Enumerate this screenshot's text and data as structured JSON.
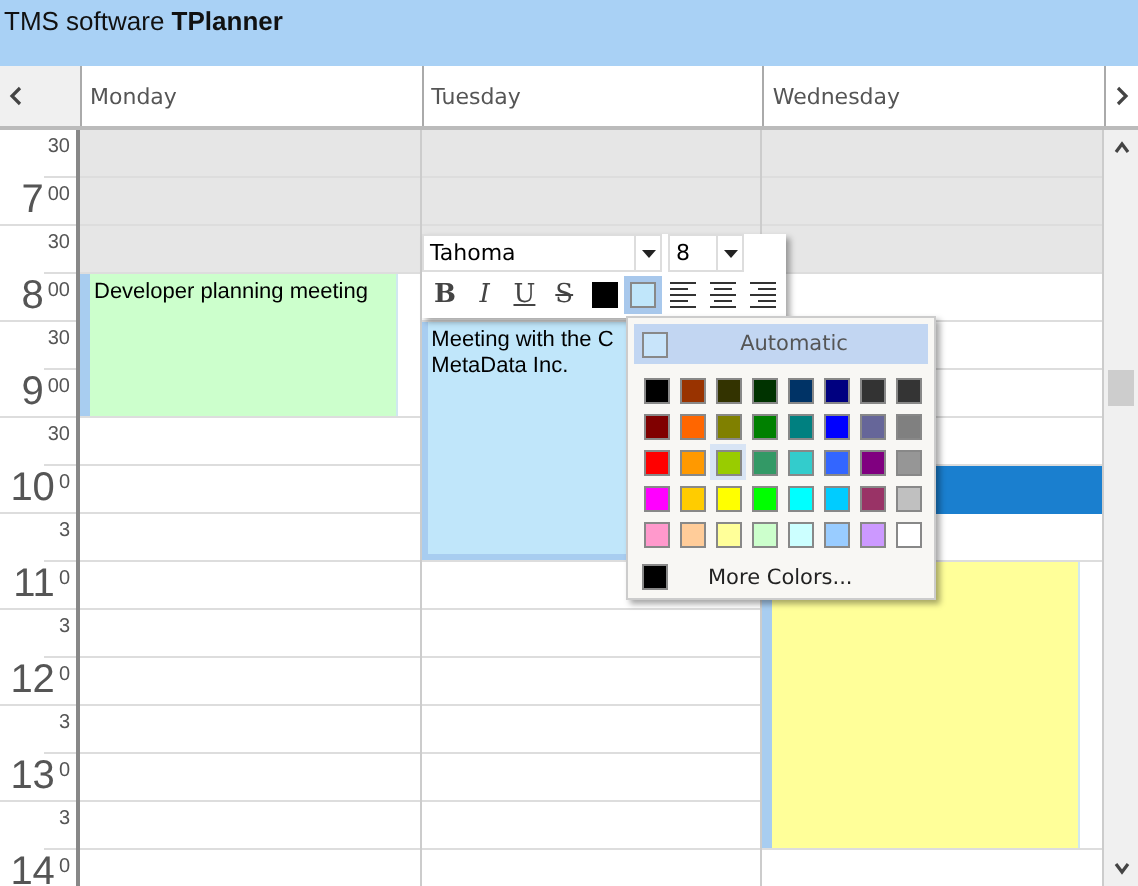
{
  "window": {
    "title_prefix": "TMS software ",
    "title_bold": "TPlanner"
  },
  "header": {
    "days": [
      {
        "label": "Monday"
      },
      {
        "label": "Tuesday"
      },
      {
        "label": "Wednesday"
      }
    ]
  },
  "time_slots": [
    {
      "minutes": "30",
      "shaded": true
    },
    {
      "hour": "7",
      "minutes": "00",
      "shaded": true
    },
    {
      "minutes": "30",
      "shaded": true
    },
    {
      "hour": "8",
      "minutes": "00",
      "shaded": false
    },
    {
      "minutes": "30",
      "shaded": false
    },
    {
      "hour": "9",
      "minutes": "00",
      "shaded": false
    },
    {
      "minutes": "30",
      "shaded": false
    },
    {
      "hour": "10",
      "minutes": "0",
      "shaded": false
    },
    {
      "minutes": "3",
      "shaded": false
    },
    {
      "hour": "11",
      "minutes": "0",
      "shaded": false
    },
    {
      "minutes": "3",
      "shaded": false
    },
    {
      "hour": "12",
      "minutes": "0",
      "shaded": false
    },
    {
      "minutes": "3",
      "shaded": false
    },
    {
      "hour": "13",
      "minutes": "0",
      "shaded": false
    },
    {
      "minutes": "3",
      "shaded": false
    },
    {
      "hour": "14",
      "minutes": "0",
      "shaded": false
    }
  ],
  "columns": [
    {
      "cells": [
        {
          "kind": "free"
        },
        {
          "kind": "free"
        },
        {
          "kind": "free"
        },
        {
          "kind": "event",
          "text": "Developer planning meeting",
          "color": "#ccffcc",
          "editing": false
        },
        {
          "kind": "continue"
        },
        {
          "kind": "continue"
        },
        {
          "kind": "free"
        },
        {
          "kind": "free"
        },
        {
          "kind": "free"
        },
        {
          "kind": "free"
        },
        {
          "kind": "free"
        },
        {
          "kind": "free"
        },
        {
          "kind": "free"
        },
        {
          "kind": "free"
        },
        {
          "kind": "free"
        },
        {
          "kind": "free"
        }
      ]
    },
    {
      "cells": [
        {
          "kind": "free"
        },
        {
          "kind": "free"
        },
        {
          "kind": "free"
        },
        {
          "kind": "free"
        },
        {
          "kind": "event",
          "text": "Meeting with the C\nMetaData Inc.",
          "color": "#c0e6fa",
          "editing": true
        },
        {
          "kind": "continue"
        },
        {
          "kind": "continue"
        },
        {
          "kind": "continue"
        },
        {
          "kind": "continue"
        },
        {
          "kind": "free"
        },
        {
          "kind": "free"
        },
        {
          "kind": "free"
        },
        {
          "kind": "free"
        },
        {
          "kind": "free"
        },
        {
          "kind": "free"
        },
        {
          "kind": "free"
        }
      ]
    },
    {
      "cells": [
        {
          "kind": "free"
        },
        {
          "kind": "free"
        },
        {
          "kind": "free"
        },
        {
          "kind": "free"
        },
        {
          "kind": "free"
        },
        {
          "kind": "free"
        },
        {
          "kind": "free"
        },
        {
          "kind": "selected"
        },
        {
          "kind": "free"
        },
        {
          "kind": "event",
          "color": "#ffff99",
          "editing": false
        },
        {
          "kind": "continue"
        },
        {
          "kind": "continue"
        },
        {
          "kind": "continue"
        },
        {
          "kind": "continue"
        },
        {
          "kind": "continue"
        },
        {
          "kind": "free"
        }
      ]
    }
  ],
  "editor_toolbar": {
    "font": "Tahoma",
    "size": "8",
    "buttons": [
      {
        "kind": "bold",
        "label": "B",
        "selected": false
      },
      {
        "kind": "italic",
        "label": "I",
        "selected": false
      },
      {
        "kind": "underline",
        "label": "U",
        "selected": false
      },
      {
        "kind": "strike",
        "label": "S",
        "selected": false
      },
      {
        "kind": "swatch",
        "color": "#000000",
        "selected": false
      },
      {
        "kind": "swatch",
        "color": "#c0e6fa",
        "selected": true
      },
      {
        "kind": "align-left",
        "selected": false
      },
      {
        "kind": "align-center",
        "selected": false
      },
      {
        "kind": "align-right",
        "selected": false
      }
    ]
  },
  "color_menu": {
    "automatic": "Automatic",
    "more": "More Colors...",
    "swatches": [
      {
        "color": "#000000",
        "selected": false
      },
      {
        "color": "#993300",
        "selected": false
      },
      {
        "color": "#333300",
        "selected": false
      },
      {
        "color": "#003300",
        "selected": false
      },
      {
        "color": "#003366",
        "selected": false
      },
      {
        "color": "#000080",
        "selected": false
      },
      {
        "color": "#333333",
        "selected": false
      },
      {
        "color": "#343434",
        "selected": false
      },
      {
        "color": "#800000",
        "selected": false
      },
      {
        "color": "#ff6600",
        "selected": false
      },
      {
        "color": "#808000",
        "selected": false
      },
      {
        "color": "#008000",
        "selected": false
      },
      {
        "color": "#008080",
        "selected": false
      },
      {
        "color": "#0000ff",
        "selected": false
      },
      {
        "color": "#666699",
        "selected": false
      },
      {
        "color": "#808080",
        "selected": false
      },
      {
        "color": "#ff0000",
        "selected": false
      },
      {
        "color": "#ff9900",
        "selected": false
      },
      {
        "color": "#99cc00",
        "selected": true
      },
      {
        "color": "#339966",
        "selected": false
      },
      {
        "color": "#33cccc",
        "selected": false
      },
      {
        "color": "#3366ff",
        "selected": false
      },
      {
        "color": "#800080",
        "selected": false
      },
      {
        "color": "#969696",
        "selected": false
      },
      {
        "color": "#ff00ff",
        "selected": false
      },
      {
        "color": "#ffcc00",
        "selected": false
      },
      {
        "color": "#ffff00",
        "selected": false
      },
      {
        "color": "#00ff00",
        "selected": false
      },
      {
        "color": "#00ffff",
        "selected": false
      },
      {
        "color": "#00ccff",
        "selected": false
      },
      {
        "color": "#993366",
        "selected": false
      },
      {
        "color": "#c0c0c0",
        "selected": false
      },
      {
        "color": "#ff99cc",
        "selected": false
      },
      {
        "color": "#ffcc99",
        "selected": false
      },
      {
        "color": "#ffff99",
        "selected": false
      },
      {
        "color": "#ccffcc",
        "selected": false
      },
      {
        "color": "#ccffff",
        "selected": false
      },
      {
        "color": "#99ccff",
        "selected": false
      },
      {
        "color": "#cc99ff",
        "selected": false
      },
      {
        "color": "#ffffff",
        "selected": false
      }
    ]
  }
}
